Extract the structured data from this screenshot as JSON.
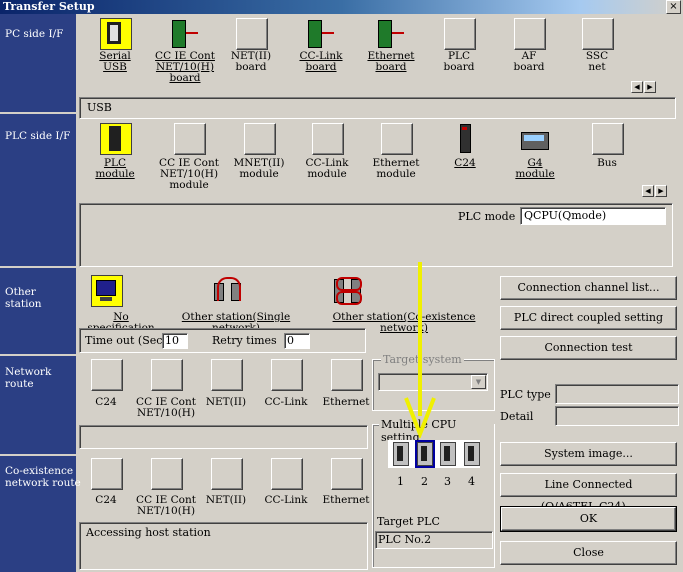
{
  "window": {
    "title": "Transfer Setup",
    "close": "×"
  },
  "sidebar": {
    "pc_side": "PC side I/F",
    "plc_side": "PLC side I/F",
    "other_station": "Other\nstation",
    "network_route": "Network\nroute",
    "coexistence_route": "Co-existence\nnetwork route"
  },
  "pc_side": {
    "items": [
      {
        "label": "Serial\nUSB",
        "underline": true
      },
      {
        "label": "CC IE Cont\nNET/10(H)\nboard",
        "underline": true
      },
      {
        "label": "NET(II)\nboard",
        "underline": false
      },
      {
        "label": "CC-Link\nboard",
        "underline": true
      },
      {
        "label": "Ethernet\nboard",
        "underline": true
      },
      {
        "label": "PLC\nboard",
        "underline": false
      },
      {
        "label": "AF\nboard",
        "underline": false
      },
      {
        "label": "SSC\nnet",
        "underline": false
      }
    ],
    "info": "USB"
  },
  "plc_side": {
    "items": [
      {
        "label": "PLC\nmodule",
        "underline": true
      },
      {
        "label": "CC IE Cont\nNET/10(H)\nmodule",
        "underline": false
      },
      {
        "label": "MNET(II)\nmodule",
        "underline": false
      },
      {
        "label": "CC-Link\nmodule",
        "underline": false
      },
      {
        "label": "Ethernet\nmodule",
        "underline": false
      },
      {
        "label": "C24",
        "underline": true
      },
      {
        "label": "G4\nmodule",
        "underline": true
      },
      {
        "label": "Bus",
        "underline": false
      }
    ],
    "plc_mode_label": "PLC mode",
    "plc_mode_value": "QCPU(Qmode)"
  },
  "other_station": {
    "items": [
      {
        "label": "No specification"
      },
      {
        "label": "Other station(Single network)"
      },
      {
        "label": "Other station(Co-existence network)"
      }
    ],
    "timeout_label": "Time out (Sec.)",
    "timeout_value": "10",
    "retry_label": "Retry times",
    "retry_value": "0"
  },
  "network_route": {
    "items": [
      "C24",
      "CC IE Cont\nNET/10(H)",
      "NET(II)",
      "CC-Link",
      "Ethernet"
    ]
  },
  "coexistence_route": {
    "items": [
      "C24",
      "CC IE Cont\nNET/10(H)",
      "NET(II)",
      "CC-Link",
      "Ethernet"
    ],
    "status": "Accessing host station"
  },
  "target_system": {
    "label": "Target system"
  },
  "multiple_cpu": {
    "label": "Multiple CPU setting",
    "cpus": [
      "1",
      "2",
      "3",
      "4"
    ],
    "selected": "2",
    "target_label": "Target PLC",
    "target_value": "PLC No.2"
  },
  "right_panel": {
    "connection_channel_list": "Connection channel  list...",
    "plc_direct_coupled": "PLC direct coupled setting",
    "connection_test": "Connection test",
    "plc_type_label": "PLC type",
    "detail_label": "Detail",
    "system_image": "System   image...",
    "line_connected": "Line Connected  (Q/A6TEL,C24)...",
    "ok": "OK",
    "close": "Close"
  },
  "colors": {
    "sidebar": "#2b3f84",
    "annotation_arrow": "#f0f000",
    "selected_icon_bg": "#ffff00"
  }
}
